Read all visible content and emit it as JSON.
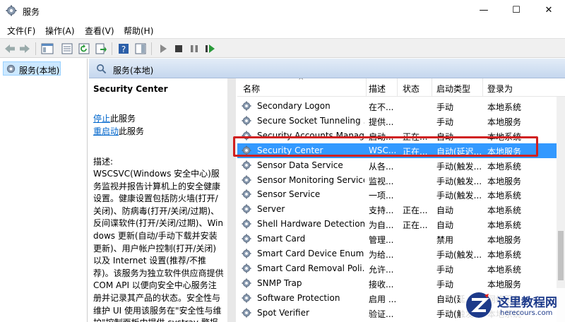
{
  "window": {
    "title": "服务",
    "controls": {
      "minimize": "—",
      "maximize": "☐",
      "close": "✕"
    }
  },
  "menu": [
    "文件(F)",
    "操作(A)",
    "查看(V)",
    "帮助(H)"
  ],
  "tree": {
    "item": "服务(本地)"
  },
  "main_header": "服务(本地)",
  "description": {
    "title": "Security Center",
    "stop_link": "停止",
    "stop_suffix": "此服务",
    "restart_link": "重启动",
    "restart_suffix": "此服务",
    "label": "描述:",
    "body": "WSCSVC(Windows 安全中心)服务监视并报告计算机上的安全健康设置。健康设置包括防火墙(打开/关闭)、防病毒(打开/关闭/过期)、反间谍软件(打开/关闭/过期)、Windows 更新(自动/手动下载并安装更新)、用户帐户控制(打开/关闭)以及 Internet 设置(推荐/不推荐)。该服务为独立软件供应商提供 COM API 以便向安全中心服务注册并记录其产品的状态。安全性与维护 UI 使用该服务在\"安全性与维护\"控制面板中提供 systray 警报"
  },
  "table": {
    "sort_indicator": "^",
    "columns": [
      "名称",
      "描述",
      "状态",
      "启动类型",
      "登录为"
    ],
    "rows": [
      [
        "Secondary Logon",
        "在不...",
        "",
        "手动",
        "本地系统"
      ],
      [
        "Secure Socket Tunneling ...",
        "提供...",
        "",
        "手动",
        "本地服务"
      ],
      [
        "Security Accounts Manag...",
        "启动...",
        "正在...",
        "自动",
        "本地系统"
      ],
      [
        "Security Center",
        "WSC...",
        "正在...",
        "自动(延迟...",
        "本地服务"
      ],
      [
        "Sensor Data Service",
        "从各...",
        "",
        "手动(触发...",
        "本地系统"
      ],
      [
        "Sensor Monitoring Service",
        "监视...",
        "",
        "手动(触发...",
        "本地服务"
      ],
      [
        "Sensor Service",
        "一项...",
        "",
        "手动(触发...",
        "本地系统"
      ],
      [
        "Server",
        "支持...",
        "正在...",
        "自动",
        "本地系统"
      ],
      [
        "Shell Hardware Detection",
        "为自...",
        "正在...",
        "自动",
        "本地系统"
      ],
      [
        "Smart Card",
        "管理...",
        "",
        "禁用",
        "本地服务"
      ],
      [
        "Smart Card Device Enum...",
        "为给...",
        "",
        "手动(触发...",
        "本地系统"
      ],
      [
        "Smart Card Removal Poli...",
        "允许...",
        "",
        "手动",
        "本地系统"
      ],
      [
        "SNMP Trap",
        "接收...",
        "",
        "手动",
        "本地服务"
      ],
      [
        "Software Protection",
        "启用 ...",
        "",
        "自动(延...",
        "网络服务"
      ],
      [
        "Spot Verifier",
        "验证...",
        "",
        "手动(触发...",
        "本地系统"
      ]
    ]
  },
  "watermark": {
    "text": "这里教程网",
    "sub": "herecours.com"
  },
  "colors": {
    "selected": "#3399ff",
    "highlight_box": "#d02020",
    "link": "#0066cc"
  }
}
